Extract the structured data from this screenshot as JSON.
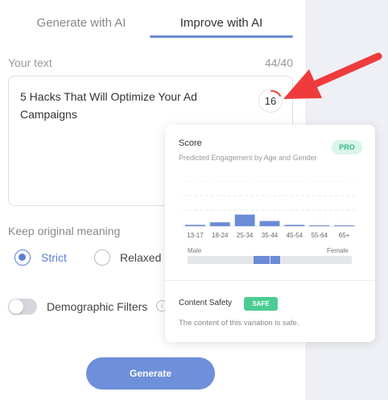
{
  "tabs": [
    {
      "label": "Generate with AI",
      "active": false
    },
    {
      "label": "Improve with AI",
      "active": true
    }
  ],
  "editor": {
    "label": "Your text",
    "char_count": "44/40",
    "text": "5 Hacks That Will Optimize Your Ad Campaigns",
    "score": "16"
  },
  "meaning": {
    "label": "Keep original meaning",
    "options": [
      {
        "label": "Strict",
        "selected": true
      },
      {
        "label": "Relaxed",
        "selected": false
      }
    ]
  },
  "demographics": {
    "label": "Demographic Filters",
    "enabled": false,
    "info_icon": "i"
  },
  "generate_label": "Generate",
  "popover": {
    "score_label": "Score",
    "subtitle": "Predicted Engagement by Age and Gender",
    "pro_label": "PRO",
    "male_label": "Male",
    "female_label": "Female",
    "gender_share": {
      "male": 0.1,
      "female": 0.06
    },
    "safety_label": "Content Safety",
    "safe_label": "SAFE",
    "safety_desc": "The content of this variation is safe."
  },
  "chart_data": {
    "type": "bar",
    "categories": [
      "13-17",
      "18-24",
      "25-34",
      "35-44",
      "45-54",
      "55-64",
      "65+"
    ],
    "values": [
      1,
      3,
      9,
      4,
      1,
      0.5,
      0.5
    ],
    "ylim": [
      0,
      35
    ],
    "grid": true,
    "bar_color": "#6b8bd6"
  },
  "colors": {
    "accent": "#6e8fd9",
    "safe": "#4ccc93",
    "arrow": "#ef3b3b",
    "score_ring": "#e84a3c"
  }
}
